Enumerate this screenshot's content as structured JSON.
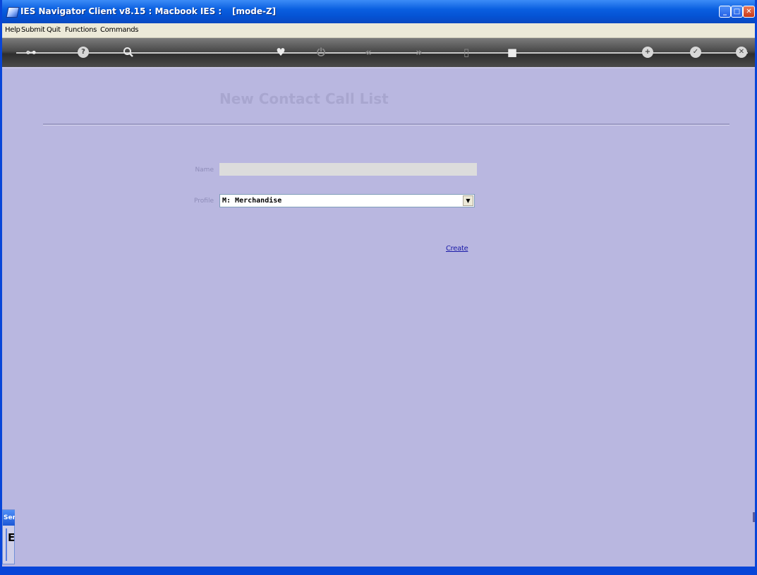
{
  "window": {
    "title": "IES Navigator Client v8.15 : Macbook IES :",
    "mode": "[mode-Z]",
    "minimize_glyph": "_",
    "maximize_glyph": "□",
    "close_glyph": "✕"
  },
  "menu": {
    "items": [
      "Help",
      "Submit",
      "Quit",
      "Functions",
      "Commands"
    ]
  },
  "toolbar": {
    "icons": [
      {
        "name": "key-icon",
        "glyph": "⊶"
      },
      {
        "name": "help-icon",
        "glyph": "?"
      },
      {
        "name": "search-icon",
        "glyph": "🔍"
      },
      {
        "name": "heart-icon",
        "glyph": "♥"
      },
      {
        "name": "power-icon",
        "glyph": "⏻"
      },
      {
        "name": "previous-icon",
        "glyph": "«"
      },
      {
        "name": "next-icon",
        "glyph": "»"
      },
      {
        "name": "list-icon",
        "glyph": "▯"
      },
      {
        "name": "stop-icon",
        "glyph": "■"
      },
      {
        "name": "plus-icon",
        "glyph": "+"
      },
      {
        "name": "check-icon",
        "glyph": "✓"
      },
      {
        "name": "close-icon",
        "glyph": "✕"
      }
    ]
  },
  "form": {
    "title": "New Contact Call List",
    "name_label": "Name",
    "name_value": "",
    "profile_label": "Profile",
    "profile_value": "M: Merchandise",
    "profile_arrow": "▼",
    "create_label": "Create"
  },
  "side_panel": {
    "header": "Ser",
    "char": "E"
  },
  "colors": {
    "background": "#b9b7e0",
    "title_bar": "#0553d4",
    "toolbar": "#3a3a3a",
    "link": "#1a1aa8"
  }
}
